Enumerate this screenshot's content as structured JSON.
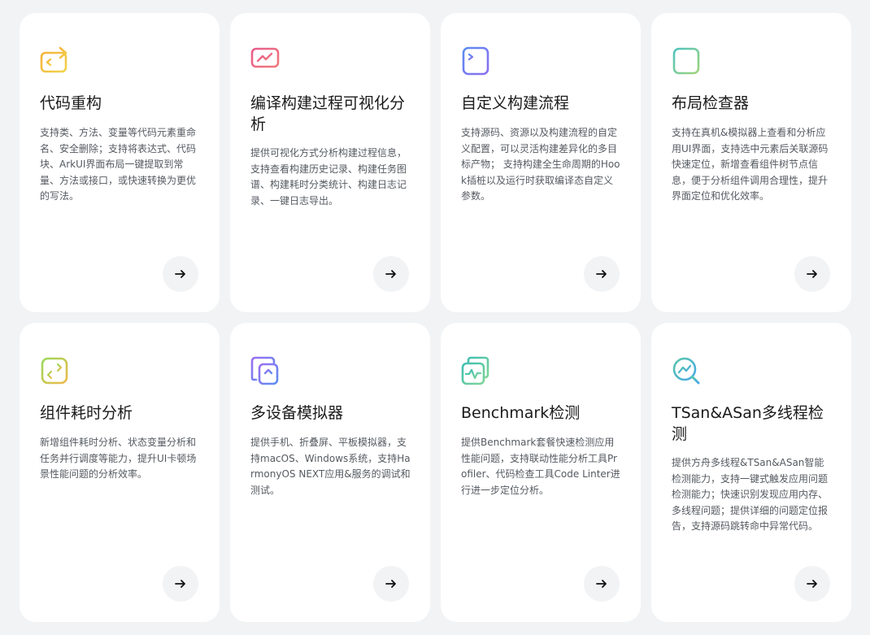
{
  "cards": [
    {
      "icon": "refactor-code-icon",
      "title": "代码重构",
      "desc": "支持类、方法、变量等代码元素重命名、安全删除；支持将表达式、代码块、ArkUI界面布局一键提取到常量、方法或接口，或快速转换为更优的写法。",
      "arrow": "arrow-right-icon"
    },
    {
      "icon": "build-visualization-icon",
      "title": "编译构建过程可视化分析",
      "desc": "提供可视化方式分析构建过程信息，支持查看构建历史记录、构建任务图谱、构建耗时分类统计、构建日志记录、一键日志导出。",
      "arrow": "arrow-right-icon"
    },
    {
      "icon": "custom-build-icon",
      "title": "自定义构建流程",
      "desc": "支持源码、资源以及构建流程的自定义配置，可以灵活构建差异化的多目标产物； 支持构建全生命周期的Hook插桩以及运行时获取编译态自定义参数。",
      "arrow": "arrow-right-icon"
    },
    {
      "icon": "layout-inspector-icon",
      "title": "布局检查器",
      "desc": "支持在真机&模拟器上查看和分析应用UI界面，支持选中元素后关联源码快速定位，新增查看组件树节点信息，便于分析组件调用合理性，提升界面定位和优化效率。",
      "arrow": "arrow-right-icon"
    },
    {
      "icon": "component-timing-icon",
      "title": "组件耗时分析",
      "desc": "新增组件耗时分析、状态变量分析和任务并行调度等能力，提升UI卡顿场景性能问题的分析效率。",
      "arrow": "arrow-right-icon"
    },
    {
      "icon": "multi-device-emulator-icon",
      "title": "多设备模拟器",
      "desc": "提供手机、折叠屏、平板模拟器，支持macOS、Windows系统，支持HarmonyOS NEXT应用&服务的调试和测试。",
      "arrow": "arrow-right-icon"
    },
    {
      "icon": "benchmark-icon",
      "title": "Benchmark检测",
      "desc": "提供Benchmark套餐快速检测应用性能问题，支持联动性能分析工具Profiler、代码检查工具Code Linter进行进一步定位分析。",
      "arrow": "arrow-right-icon"
    },
    {
      "icon": "tsan-asan-icon",
      "title": "TSan&ASan多线程检测",
      "desc": "提供方舟多线程&TSan&ASan智能检测能力，支持一键式触发应用问题检测能力；快速识别发现应用内存、多线程问题；提供详细的问题定位报告，支持源码跳转命中异常代码。",
      "arrow": "arrow-right-icon"
    }
  ],
  "colors": {
    "page_bg": "#f1f3f5",
    "card_bg": "#ffffff",
    "arrow_bg": "#f2f3f5",
    "title": "#1a1a1a",
    "desc": "#555a60"
  }
}
